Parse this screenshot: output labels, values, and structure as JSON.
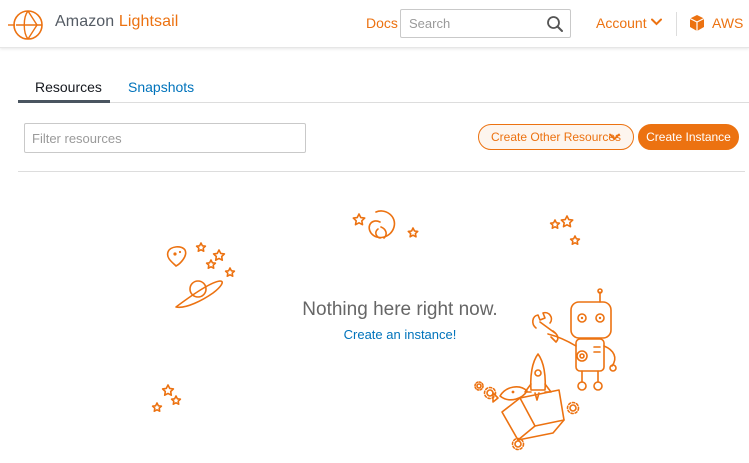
{
  "header": {
    "brand_prefix": "Amazon",
    "brand_name": "Lightsail",
    "docs_label": "Docs",
    "search_placeholder": "Search",
    "account_label": "Account",
    "aws_label": "AWS"
  },
  "tabs": [
    {
      "label": "Resources",
      "active": true
    },
    {
      "label": "Snapshots",
      "active": false
    }
  ],
  "toolbar": {
    "filter_placeholder": "Filter resources",
    "create_other_label": "Create Other Resources",
    "create_instance_label": "Create Instance"
  },
  "empty_state": {
    "title": "Nothing here right now.",
    "link": "Create an instance!"
  },
  "colors": {
    "accent": "#ec7211",
    "link": "#0073bb",
    "text": "#545b64"
  },
  "icons": [
    "lightsail-logo-icon",
    "search-icon",
    "chevron-down-icon",
    "aws-box-icon"
  ]
}
